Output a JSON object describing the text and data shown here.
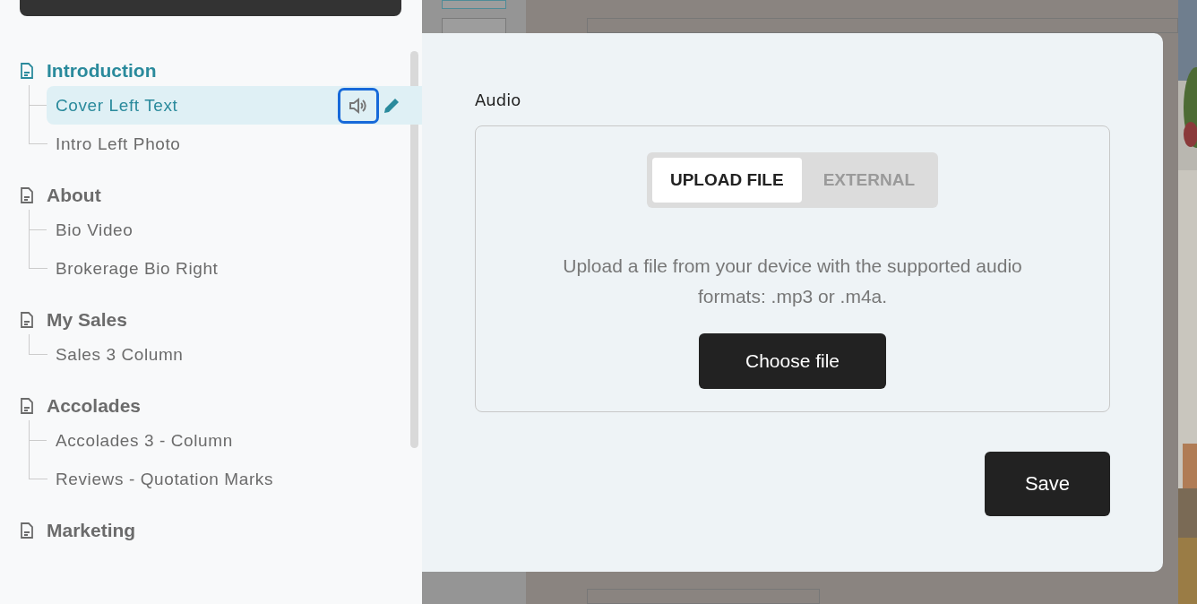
{
  "sidebar": {
    "sections": [
      {
        "title": "Introduction",
        "selected": true,
        "children": [
          {
            "label": "Cover Left Text",
            "selected": true,
            "audio_focused": true
          },
          {
            "label": "Intro Left Photo",
            "selected": false
          }
        ]
      },
      {
        "title": "About",
        "selected": false,
        "children": [
          {
            "label": "Bio Video",
            "selected": false
          },
          {
            "label": "Brokerage Bio Right",
            "selected": false
          }
        ]
      },
      {
        "title": "My Sales",
        "selected": false,
        "children": [
          {
            "label": "Sales 3 Column",
            "selected": false
          }
        ]
      },
      {
        "title": "Accolades",
        "selected": false,
        "children": [
          {
            "label": "Accolades 3 - Column",
            "selected": false
          },
          {
            "label": "Reviews - Quotation Marks",
            "selected": false
          }
        ]
      },
      {
        "title": "Marketing",
        "selected": false
      }
    ]
  },
  "modal": {
    "label": "Audio",
    "tabs": [
      {
        "label": "UPLOAD FILE",
        "selected": true
      },
      {
        "label": "EXTERNAL",
        "selected": false
      }
    ],
    "description": "Upload a file from your device with the supported audio formats: .mp3 or .m4a.",
    "choose_button": "Choose file",
    "save_button": "Save"
  }
}
